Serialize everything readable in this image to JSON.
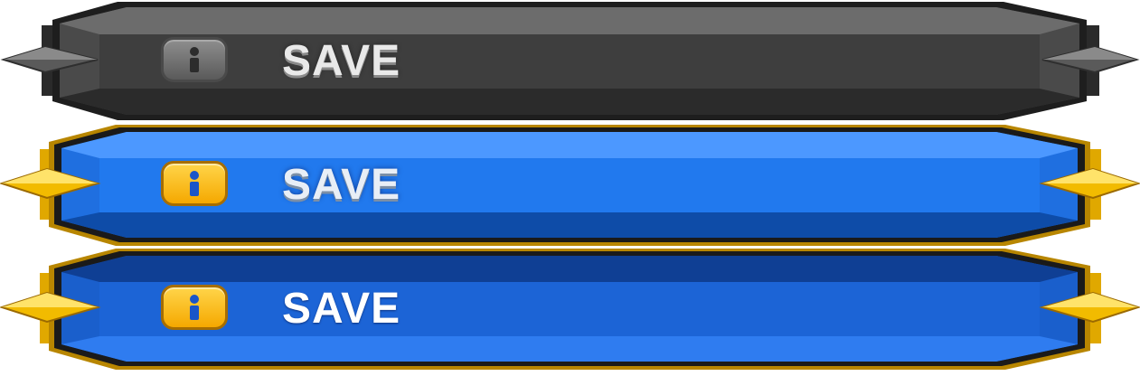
{
  "buttons": [
    {
      "state": "default",
      "label": "SAVE",
      "icon": "info-person-icon",
      "fill": "#3c3c3c",
      "rim": "#262626",
      "accent": "#555555"
    },
    {
      "state": "hover",
      "label": "SAVE",
      "icon": "info-person-icon",
      "fill": "#1f73e6",
      "rim": "#c99700",
      "accent": "#f7c700"
    },
    {
      "state": "pressed",
      "label": "SAVE",
      "icon": "info-person-icon",
      "fill": "#1a5fcc",
      "rim": "#c99700",
      "accent": "#f7c700"
    }
  ]
}
